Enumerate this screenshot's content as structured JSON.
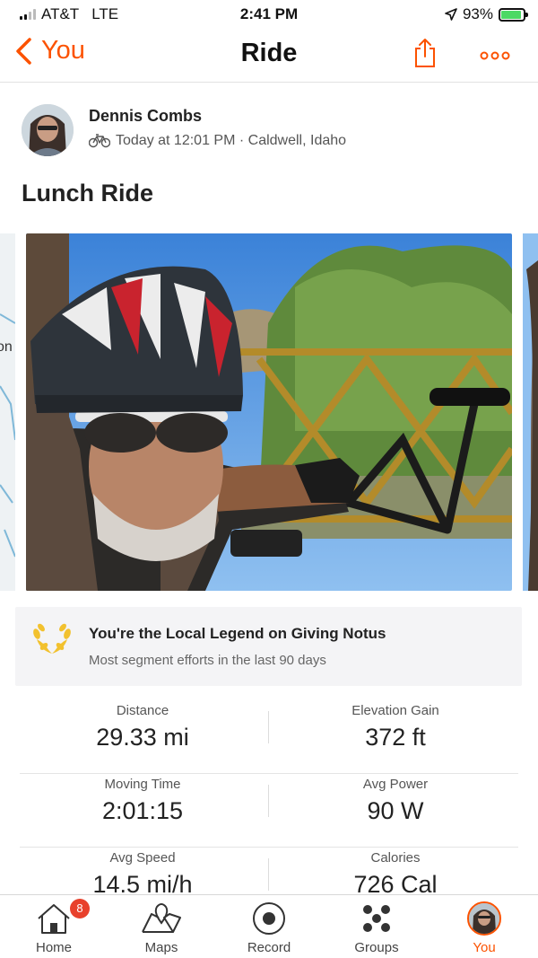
{
  "status_bar": {
    "carrier": "AT&T",
    "network": "LTE",
    "time": "2:41 PM",
    "battery": "93%",
    "battery_level": 0.93
  },
  "nav": {
    "back_label": "You",
    "title": "Ride"
  },
  "athlete": {
    "name": "Dennis Combs",
    "activity_meta": "Today at 12:01 PM · Caldwell, Idaho",
    "activity_icon": "bike-icon"
  },
  "activity": {
    "title": "Lunch Ride"
  },
  "map_preview": {
    "label_fragment": "on"
  },
  "legend": {
    "title": "You're the Local Legend on Giving Notus",
    "subtitle": "Most segment efforts in the last 90 days",
    "icon": "laurel-icon"
  },
  "stats": [
    {
      "label": "Distance",
      "value": "29.33 mi"
    },
    {
      "label": "Elevation Gain",
      "value": "372 ft"
    },
    {
      "label": "Moving Time",
      "value": "2:01:15"
    },
    {
      "label": "Avg Power",
      "value": "90 W"
    },
    {
      "label": "Avg Speed",
      "value": "14.5 mi/h"
    },
    {
      "label": "Calories",
      "value": "726 Cal"
    }
  ],
  "tabs": [
    {
      "label": "Home",
      "icon": "home-icon",
      "badge": "8"
    },
    {
      "label": "Maps",
      "icon": "map-icon"
    },
    {
      "label": "Record",
      "icon": "record-icon"
    },
    {
      "label": "Groups",
      "icon": "groups-icon"
    },
    {
      "label": "You",
      "icon": "avatar",
      "active": true
    }
  ],
  "colors": {
    "accent": "#fc5200",
    "badge": "#e8412c",
    "legend_gold": "#f2c12e",
    "card_bg": "#f4f4f6"
  }
}
